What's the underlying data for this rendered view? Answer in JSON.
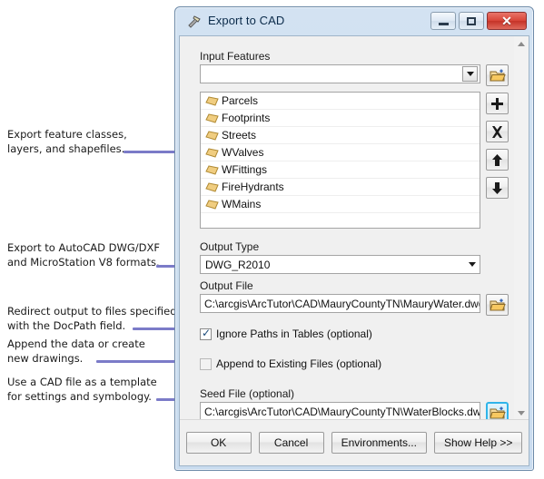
{
  "dialog": {
    "title": "Export to CAD",
    "title_icon": "hammer-tool-icon",
    "window_controls": {
      "minimize": "minimize-icon",
      "maximize": "maximize-icon",
      "close": "✕"
    }
  },
  "form": {
    "input_features": {
      "label": "Input Features",
      "value": "",
      "browse_icon": "open-folder-icon",
      "add_icon": "plus-icon",
      "remove_icon": "x-icon",
      "move_up_icon": "arrow-up-icon",
      "move_down_icon": "arrow-down-icon"
    },
    "feature_list": [
      {
        "name": "Parcels",
        "icon": "polygon-feature-icon"
      },
      {
        "name": "Footprints",
        "icon": "polygon-feature-icon"
      },
      {
        "name": "Streets",
        "icon": "polygon-feature-icon"
      },
      {
        "name": "WValves",
        "icon": "polygon-feature-icon"
      },
      {
        "name": "WFittings",
        "icon": "polygon-feature-icon"
      },
      {
        "name": "FireHydrants",
        "icon": "polygon-feature-icon"
      },
      {
        "name": "WMains",
        "icon": "polygon-feature-icon"
      }
    ],
    "output_type": {
      "label": "Output Type",
      "value": "DWG_R2010"
    },
    "output_file": {
      "label": "Output File",
      "value": "C:\\arcgis\\ArcTutor\\CAD\\MauryCountyTN\\MauryWater.dwg",
      "browse_icon": "open-folder-icon"
    },
    "ignore_paths": {
      "label": "Ignore Paths in Tables (optional)",
      "checked": true
    },
    "append_existing": {
      "label": "Append to Existing Files (optional)",
      "checked": false
    },
    "seed_file": {
      "label": "Seed File (optional)",
      "value": "C:\\arcgis\\ArcTutor\\CAD\\MauryCountyTN\\WaterBlocks.dwg",
      "browse_icon": "open-folder-icon"
    }
  },
  "footer": {
    "ok": "OK",
    "cancel": "Cancel",
    "environments": "Environments...",
    "show_help": "Show Help >>"
  },
  "annotations": [
    {
      "text": "Export feature classes,\nlayers, and shapefiles."
    },
    {
      "text": "Export to AutoCAD DWG/DXF\nand MicroStation V8 formats."
    },
    {
      "text": "Redirect output to files specified\nwith the DocPath field."
    },
    {
      "text": "Append the data or create\nnew drawings."
    },
    {
      "text": "Use a CAD file as a template\nfor settings and symbology."
    }
  ],
  "colors": {
    "leader": "#7b7bc8",
    "title_text": "#0b2b4a",
    "close_button": "#d9463a",
    "focus_border": "#2fb4e9",
    "feature_icon": "#e8b65a"
  }
}
